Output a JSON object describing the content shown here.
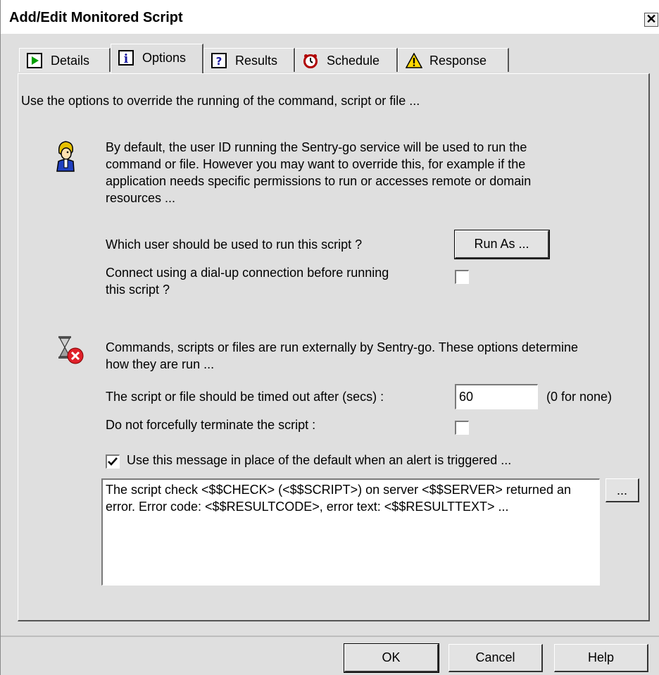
{
  "window": {
    "title": "Add/Edit Monitored Script",
    "close_glyph": "✕"
  },
  "tabs": [
    {
      "label": "Details",
      "icon": "play-icon"
    },
    {
      "label": "Options",
      "icon": "info-icon"
    },
    {
      "label": "Results",
      "icon": "question-icon"
    },
    {
      "label": "Schedule",
      "icon": "alarm-clock-icon"
    },
    {
      "label": "Response",
      "icon": "warning-icon"
    }
  ],
  "active_tab": "Options",
  "options": {
    "intro": "Use the options to override the running of the command, script or file ...",
    "user_section": {
      "icon": "user-icon",
      "description": "By default, the user ID running the Sentry-go service will be used to run the command or file. However you may want to override this, for example if the application needs specific permissions to run or accesses remote or domain resources ...",
      "run_as_question": "Which user should be used to run this script ?",
      "run_as_button": "Run As ...",
      "dialup_question": "Connect using a dial-up connection before running this script ?",
      "dialup_checked": false
    },
    "timeout_section": {
      "icon": "hourglass-error-icon",
      "description": "Commands, scripts or files are run externally by Sentry-go. These options determine how they are run ...",
      "timeout_label": "The script or file should be timed out after (secs) :",
      "timeout_value": "60",
      "timeout_hint": "(0 for none)",
      "no_terminate_label": "Do not forcefully terminate the script :",
      "no_terminate_checked": false
    },
    "message_section": {
      "use_message_label": "Use this message in place of the default when an alert is triggered ...",
      "use_message_checked": true,
      "message_text": "The script check <$$CHECK> (<$$SCRIPT>) on server <$$SERVER> returned an error. Error code: <$$RESULTCODE>, error text: <$$RESULTTEXT> ...",
      "browse_button": "..."
    }
  },
  "footer": {
    "ok": "OK",
    "cancel": "Cancel",
    "help": "Help"
  },
  "colors": {
    "dialog_bg": "#dfdfdf",
    "details_icon_green": "#00a000",
    "info_icon_blue": "#1a1aa0",
    "warning_yellow": "#ffd800",
    "error_red": "#e0202a"
  }
}
